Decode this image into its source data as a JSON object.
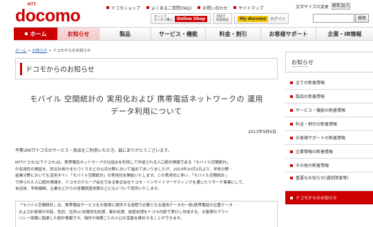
{
  "header": {
    "logo_ntt": "NTT",
    "logo_brand": "docomo",
    "top_links": [
      "ドコモショップ",
      "よくあるご質問(FAQ)",
      "お問い合わせ",
      "サイトマップ"
    ],
    "online_shop_note": "ネットで\nケータイ購入",
    "online_shop_label": "Online Shop",
    "mydocomo_note": "手続き\n料金照会",
    "mydocomo_label": "My docomo",
    "login_label": "ログイン",
    "font_size_label": "文字サイズの変更",
    "font_size_options": [
      "標準",
      "拡大"
    ],
    "search_placeholder": "",
    "search_button": "検索"
  },
  "nav": {
    "items": [
      "ホーム",
      "お知らせ",
      "製品",
      "サービス・機能",
      "料金・割引",
      "お客様サポート",
      "企業・IR情報"
    ]
  },
  "breadcrumb": {
    "home": "ホーム",
    "sep": " > ",
    "notices": "お知らせ",
    "current": "ドコモからのお知らせ"
  },
  "page": {
    "title": "ドコモからのお知らせ",
    "headline_line1": "モバイル 空間統計の 実用化および 携帯電話ネットワークの 運用",
    "headline_line2": "データ利用について",
    "date": "2013年9月6日",
    "intro": "平素はNTTドコモのサービス・商品をご利用いただき、誠にありがとうございます。",
    "para_lines": [
      "NTTドコモ(以下ドコモ)は、携帯電話ネットワークの仕組みを利用して作成される人口統計情報である「モバイル空間統計」",
      "の有用性の検証を、防災計画やまちづくりなどの公共分野において進めてまいりましたが、2013年10月1日より、学術分野・",
      "産業分野においても活用すべく「モバイル空間統計」の実用化を開始いたします。この実用化に伴い、「モバイル空間統計」",
      "で得られた人口統計情報を、ドコモのグループ会社である株式会社ドコモ・インサイトマーケティングを通じたリサーチ事業にして、",
      "自治体、学術機関、企業などからの各種調査依頼などにもとづいて提供いたします。"
    ],
    "quote_lines": [
      "「モバイル空間統計」は、携帯電話サービスをお客様に提供する過程で必要となる運用データの一部(携帯電話の位置データ",
      "およびお客様の年齢、性別、住所)に非識別化処理、集計処理、秘匿処理をドコモ内部で実行し作成する、お客様のプライ",
      "バシー保護に配慮した統計情報です。場所や時間ごとの人口の変動を推計することができます。"
    ]
  },
  "sidebar": {
    "title": "お知らせ",
    "items": [
      "全ての新着情報",
      "製品の新着情報",
      "サービス・機能の新着情報",
      "料金・割引の新着情報",
      "お客様サポートの新着情報",
      "企業情報の新着情報",
      "その他の新着情報",
      "重要なお知らせ(通信障害等)",
      "ドコモからのお知らせ"
    ]
  },
  "colors": {
    "brand_red": "#cc0000",
    "text": "#333333",
    "border": "#cccccc",
    "link": "#2a5db0"
  }
}
